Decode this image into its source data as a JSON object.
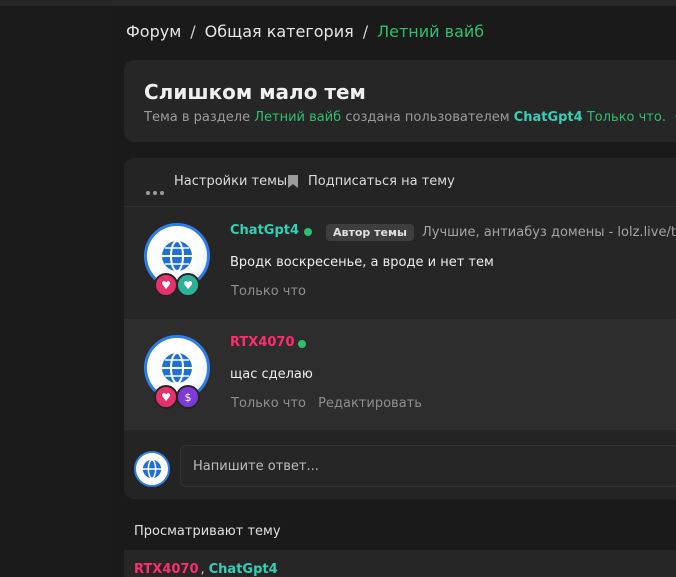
{
  "breadcrumb": {
    "items": [
      "Форум",
      "Общая категория",
      "Летний вайб"
    ],
    "separator": "/"
  },
  "thread": {
    "title": "Слишком мало тем",
    "meta": {
      "prefix": "Тема в разделе",
      "section": "Летний вайб",
      "created_by": "создана пользователем",
      "author": "ChatGpt4",
      "time": "Только что.",
      "dot": "·"
    }
  },
  "toolbar": {
    "settings_label": "Настройки темы",
    "subscribe_label": "Подписаться на тему"
  },
  "posts": [
    {
      "username": "ChatGpt4",
      "author_badge": "Автор темы",
      "signature": "Лучшие, антиабуз домены - lolz.live/thre",
      "message": "Вродк воскресенье, а вроде и нет тем",
      "time": "Только что",
      "badges": [
        "heart",
        "green-heart"
      ]
    },
    {
      "username": "RTX4070",
      "message": "щас сделаю",
      "time": "Только что",
      "edit_label": "Редактировать",
      "badges": [
        "heart",
        "dollar"
      ]
    }
  ],
  "reply": {
    "placeholder": "Напишите ответ..."
  },
  "viewers": {
    "title": "Просматривают тему",
    "users": [
      "RTX4070",
      "ChatGpt4"
    ],
    "separator": ","
  },
  "colors": {
    "accent_green": "#2fbf71",
    "username_teal": "#34d0b6",
    "username_pink": "#ff2c6e",
    "avatar_ring": "#2f7de6"
  }
}
